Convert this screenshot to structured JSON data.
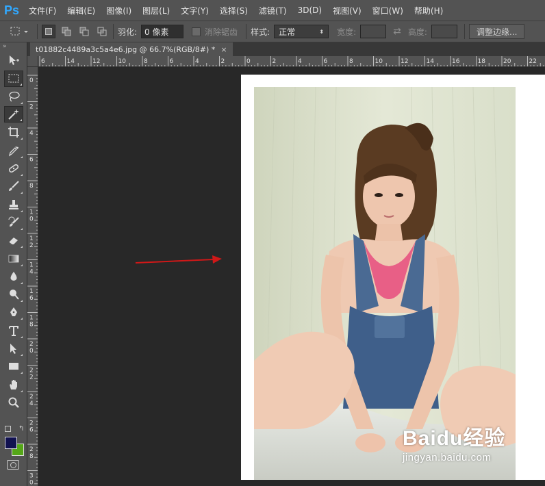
{
  "app": {
    "logo": "Ps",
    "accent": "#31a8ff"
  },
  "menubar": {
    "items": [
      "文件(F)",
      "编辑(E)",
      "图像(I)",
      "图层(L)",
      "文字(Y)",
      "选择(S)",
      "滤镜(T)",
      "3D(D)",
      "视图(V)",
      "窗口(W)",
      "帮助(H)"
    ]
  },
  "options": {
    "feather_label": "羽化:",
    "feather_value": "0 像素",
    "antialias_label": "消除锯齿",
    "style_label": "样式:",
    "style_value": "正常",
    "width_label": "宽度:",
    "height_label": "高度:",
    "refine_button": "调整边缘..."
  },
  "document": {
    "tab_title": "t01882c4489a3c5a4e6.jpg @ 66.7%(RGB/8#) *",
    "close": "×"
  },
  "ruler_h": [
    "6",
    "14",
    "12",
    "10",
    "8",
    "6",
    "4",
    "2",
    "0",
    "2",
    "4",
    "6",
    "8",
    "10",
    "12",
    "14",
    "16",
    "18",
    "20",
    "22"
  ],
  "ruler_v": [
    "0",
    "2",
    "4",
    "6",
    "8",
    "10",
    "12",
    "14",
    "16",
    "18",
    "20",
    "22",
    "24",
    "26",
    "28",
    "30"
  ],
  "tools": [
    "move-tool",
    "marquee-tool",
    "lasso-tool",
    "magic-wand-tool",
    "crop-tool",
    "eyedropper-tool",
    "healing-tool",
    "brush-tool",
    "stamp-tool",
    "history-brush-tool",
    "eraser-tool",
    "gradient-tool",
    "blur-tool",
    "dodge-tool",
    "pen-tool",
    "type-tool",
    "path-select-tool",
    "rectangle-tool",
    "hand-tool",
    "zoom-tool"
  ],
  "colors": {
    "foreground": "#111150",
    "background": "#55a618"
  },
  "annotation": {
    "arrow_color": "#d01818"
  },
  "watermark": {
    "main": "Baidu经验",
    "sub": "jingyan.baidu.com"
  }
}
